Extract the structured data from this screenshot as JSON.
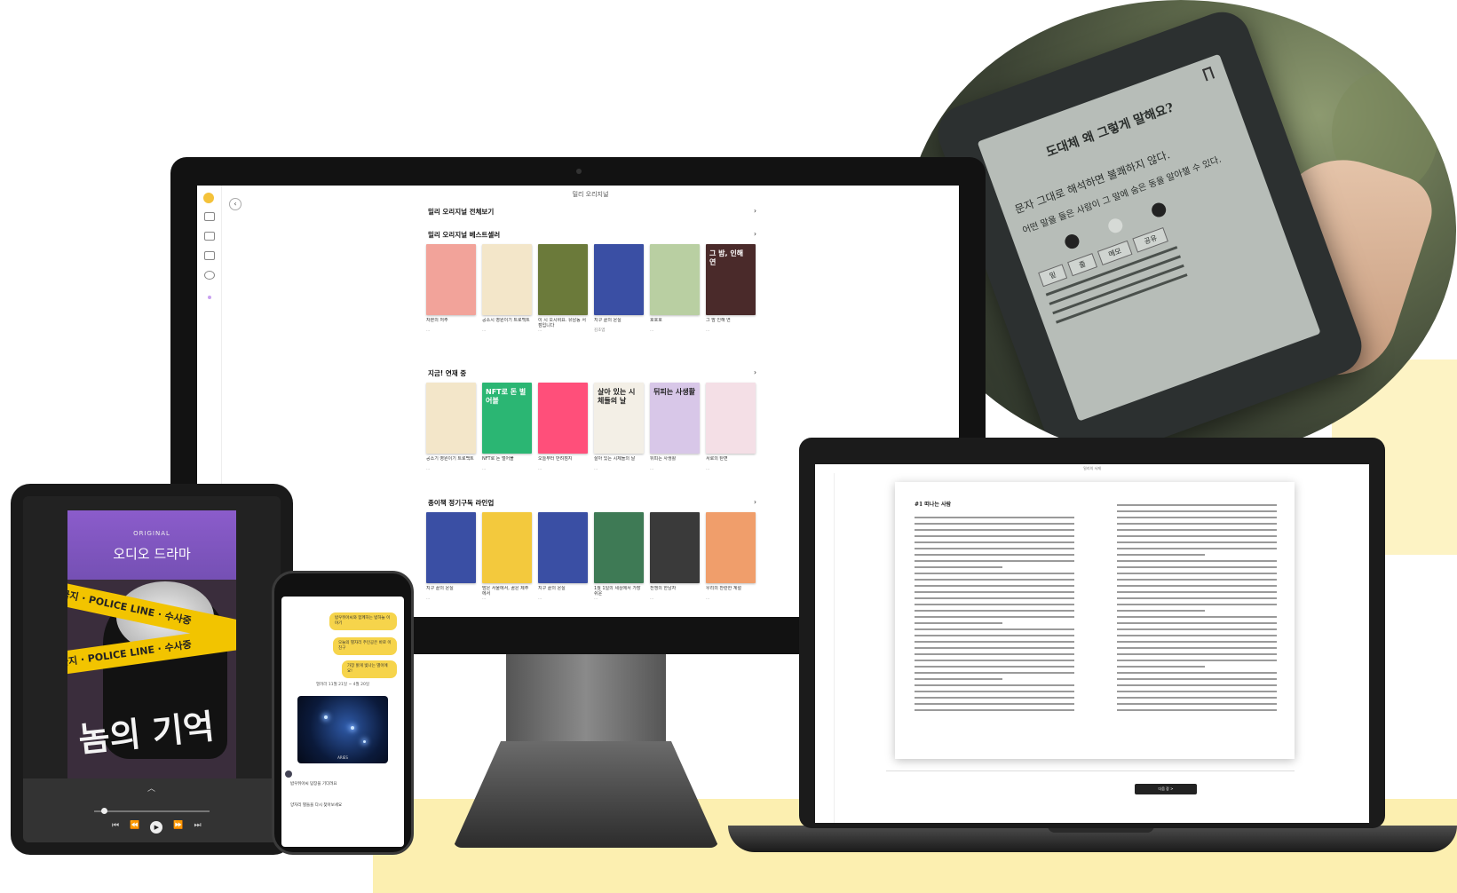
{
  "monitor": {
    "window_title": "밀리 오리지널",
    "sections": [
      {
        "title": "밀리 오리지널 전체보기",
        "books": []
      },
      {
        "title": "밀리 오리지널 베스트셀러",
        "books": [
          {
            "title": "자본의 저주",
            "author": "...",
            "cover": "#f2a39a",
            "label": ""
          },
          {
            "title": "공소시 영원이기 트로백트",
            "author": "...",
            "cover": "#f3e6c9",
            "label": ""
          },
          {
            "title": "이 시 오시비요. 유남동 서점입니다",
            "author": "...",
            "cover": "#6b7a3a",
            "label": ""
          },
          {
            "title": "지구 끝의 온실",
            "author": "김초엽",
            "cover": "#3a4fa4",
            "label": ""
          },
          {
            "title": "호호호",
            "author": "...",
            "cover": "#b9cfa2",
            "label": ""
          },
          {
            "title": "그 밤 인해 연",
            "author": "...",
            "cover": "#4a2a2a",
            "label": "그 밤, 인해 연"
          }
        ]
      },
      {
        "title": "지금! 연재 중",
        "books": [
          {
            "title": "공소기 영원이기 트로백트",
            "author": "...",
            "cover": "#f3e6c9",
            "label": ""
          },
          {
            "title": "NFT로 돈 벌어볼",
            "author": "...",
            "cover": "#2bb673",
            "label": "NFT로 돈 벌어볼"
          },
          {
            "title": "오늘부터 반려점지",
            "author": "...",
            "cover": "#ff4f7a",
            "label": ""
          },
          {
            "title": "살아 있는 시체들의 날",
            "author": "...",
            "cover": "#f3efe6",
            "label": "살아 있는 시체들의 날"
          },
          {
            "title": "뒤피는 사생활",
            "author": "...",
            "cover": "#d8c7e8",
            "label": "뒤피는 사생활"
          },
          {
            "title": "서로의 탄면",
            "author": "...",
            "cover": "#f4dfe6",
            "label": ""
          }
        ]
      },
      {
        "title": "종이책 정기구독 라인업",
        "books": [
          {
            "title": "지구 끝의 온실",
            "author": "...",
            "cover": "#3a4fa4",
            "label": ""
          },
          {
            "title": "밤은 서울에서, 꿈은 제주에서",
            "author": "...",
            "cover": "#f3c93d",
            "label": ""
          },
          {
            "title": "지구 끝의 온실",
            "author": "...",
            "cover": "#3a4fa4",
            "label": ""
          },
          {
            "title": "1월 1일의 세상에서 가장 쉬운",
            "author": "...",
            "cover": "#3e7a55",
            "label": ""
          },
          {
            "title": "전쟁의 한남자",
            "author": "...",
            "cover": "#3a3a3a",
            "label": ""
          },
          {
            "title": "우리의 찬란한 계절",
            "author": "...",
            "cover": "#f09e6b",
            "label": ""
          }
        ]
      }
    ]
  },
  "ereader": {
    "question": "도대체 왜 그렇게 말해요?",
    "text_line1": "문자 그대로 해석하면 불쾌하지 않다.",
    "text_line2": "어떤 말을 들은 사람이 그 말에 숨은 동을 알아챌 수 있다.",
    "buttons": [
      "밑",
      "줄",
      "메모",
      "공유"
    ]
  },
  "tablet": {
    "badge": "ORIGINAL",
    "category": "오디오 드라마",
    "tape1": "입금지 · POLICE LINE · 수사중",
    "tape2": "입금지 · POLICE LINE · 수사중",
    "title": "놈의 기억",
    "controls": [
      "⏮",
      "⏪",
      "⏩",
      "⏭"
    ],
    "play": "▶"
  },
  "phone": {
    "bubble1": "밤우뒤아씨와 함께하는 밤하늘 이야기",
    "bubble2": "오늘의 별자리 주인공은 바로 이 친구",
    "bubble3": "가장 밝게 빛나는 별이에요!",
    "date": "열려라 11월 21일 ~ 4월 20일",
    "image_label": "ARIES",
    "msg1": "밤우뒤아씨 답장을 기다려요",
    "msg2": "양자리 별들을 다시 찾아보세요"
  },
  "laptop": {
    "window_title": "밀리의 서재",
    "chapter": "#1 떠나는 사람",
    "next_button": "다음 장 >"
  }
}
